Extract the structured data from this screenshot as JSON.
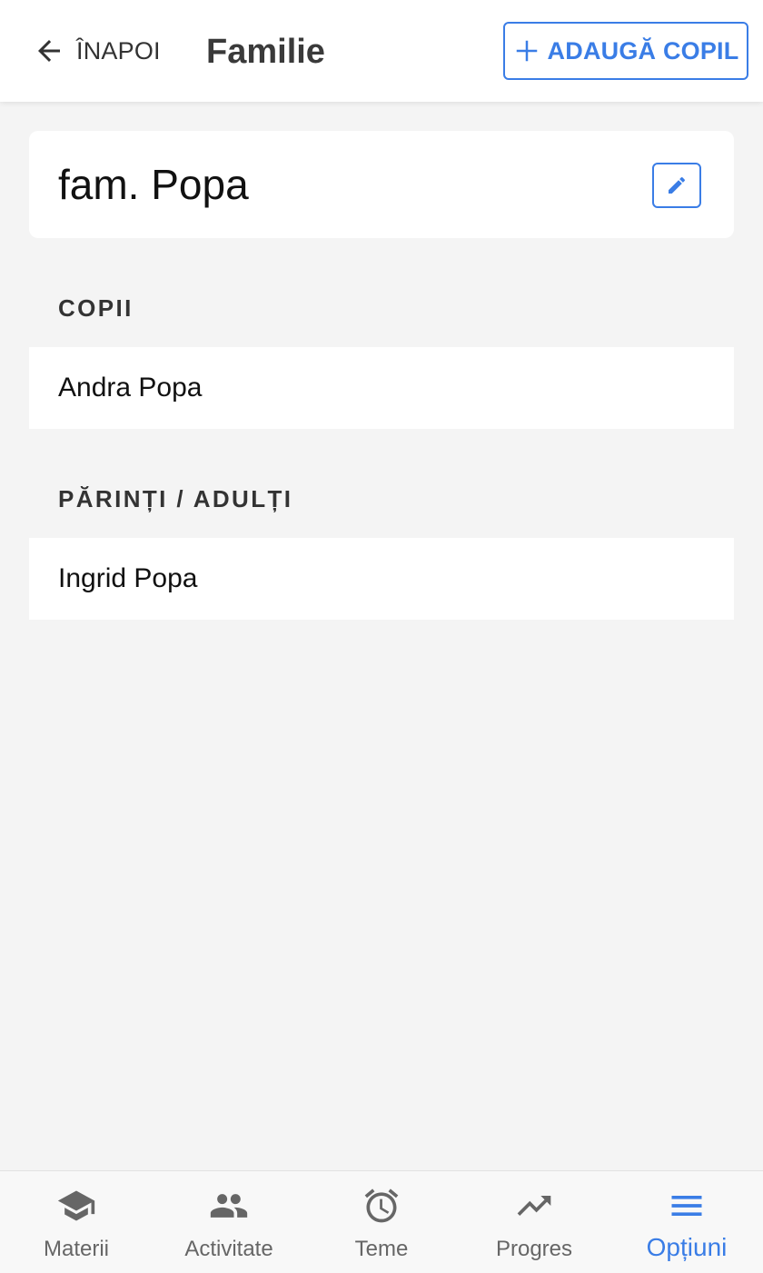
{
  "colors": {
    "accent": "#3a7de6",
    "background": "#f4f4f4",
    "surface": "#ffffff",
    "tab_inactive": "#666666",
    "heading": "#333333"
  },
  "header": {
    "back_label": "ÎNAPOI",
    "back_icon": "arrow-left-icon",
    "title": "Familie",
    "add_child_label": "ADAUGĂ COPIL",
    "add_icon": "plus-icon"
  },
  "family": {
    "name": "fam. Popa",
    "edit_icon": "pencil-icon"
  },
  "children_section": {
    "heading": "COPII",
    "items": [
      {
        "name": "Andra Popa"
      }
    ]
  },
  "adults_section": {
    "heading": "PĂRINȚI / ADULȚI",
    "items": [
      {
        "name": "Ingrid Popa"
      }
    ]
  },
  "tabbar": {
    "active": "Opțiuni",
    "tabs": [
      {
        "label": "Materii",
        "icon": "graduation-cap-icon"
      },
      {
        "label": "Activitate",
        "icon": "people-icon"
      },
      {
        "label": "Teme",
        "icon": "alarm-clock-icon"
      },
      {
        "label": "Progres",
        "icon": "trending-up-icon"
      },
      {
        "label": "Opțiuni",
        "icon": "menu-icon"
      }
    ]
  }
}
